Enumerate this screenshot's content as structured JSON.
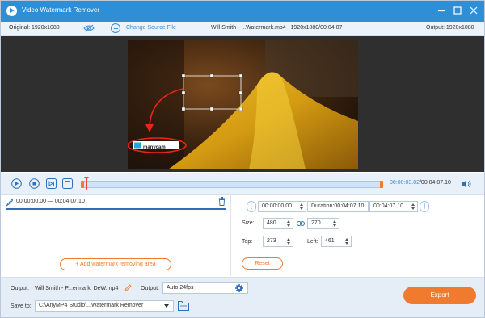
{
  "window": {
    "title": "Video Watermark Remover",
    "colors": {
      "accent": "#2e8fd6",
      "orange": "#f07b2f"
    }
  },
  "infobar": {
    "original_label": "Original: 1920x1080",
    "change_source": "Change Source File",
    "file_info": "Will Smith - ...Watermark.mp4   1920x1080/00:04:07",
    "output_label": "Output: 1920x1080"
  },
  "preview": {
    "watermark_text": "manycam"
  },
  "controls": {
    "current_time": "00:00:03.02",
    "total_time": "/00:04:07.10"
  },
  "left": {
    "range_text": "00:00:00.00 — 00:04:07.10",
    "add_area_label": "Add watermark removing area"
  },
  "right": {
    "start_time": "00:00:00.00",
    "duration": "Duration:00:04:07.10",
    "end_time": "00:04:07.10",
    "size_label": "Size:",
    "width": "480",
    "height": "270",
    "top_label": "Top:",
    "top": "273",
    "left_label": "Left:",
    "left": "461",
    "reset_label": "Reset"
  },
  "bottom": {
    "output_label": "Output:",
    "output_file": "Will Smith - P...ermark_DeW.mp4",
    "output2_label": "Output:",
    "output_format": "Auto;24fps",
    "save_to_label": "Save to:",
    "save_path": "C:\\AnyMP4 Studio\\...Watermark Remover",
    "export_label": "Export"
  }
}
